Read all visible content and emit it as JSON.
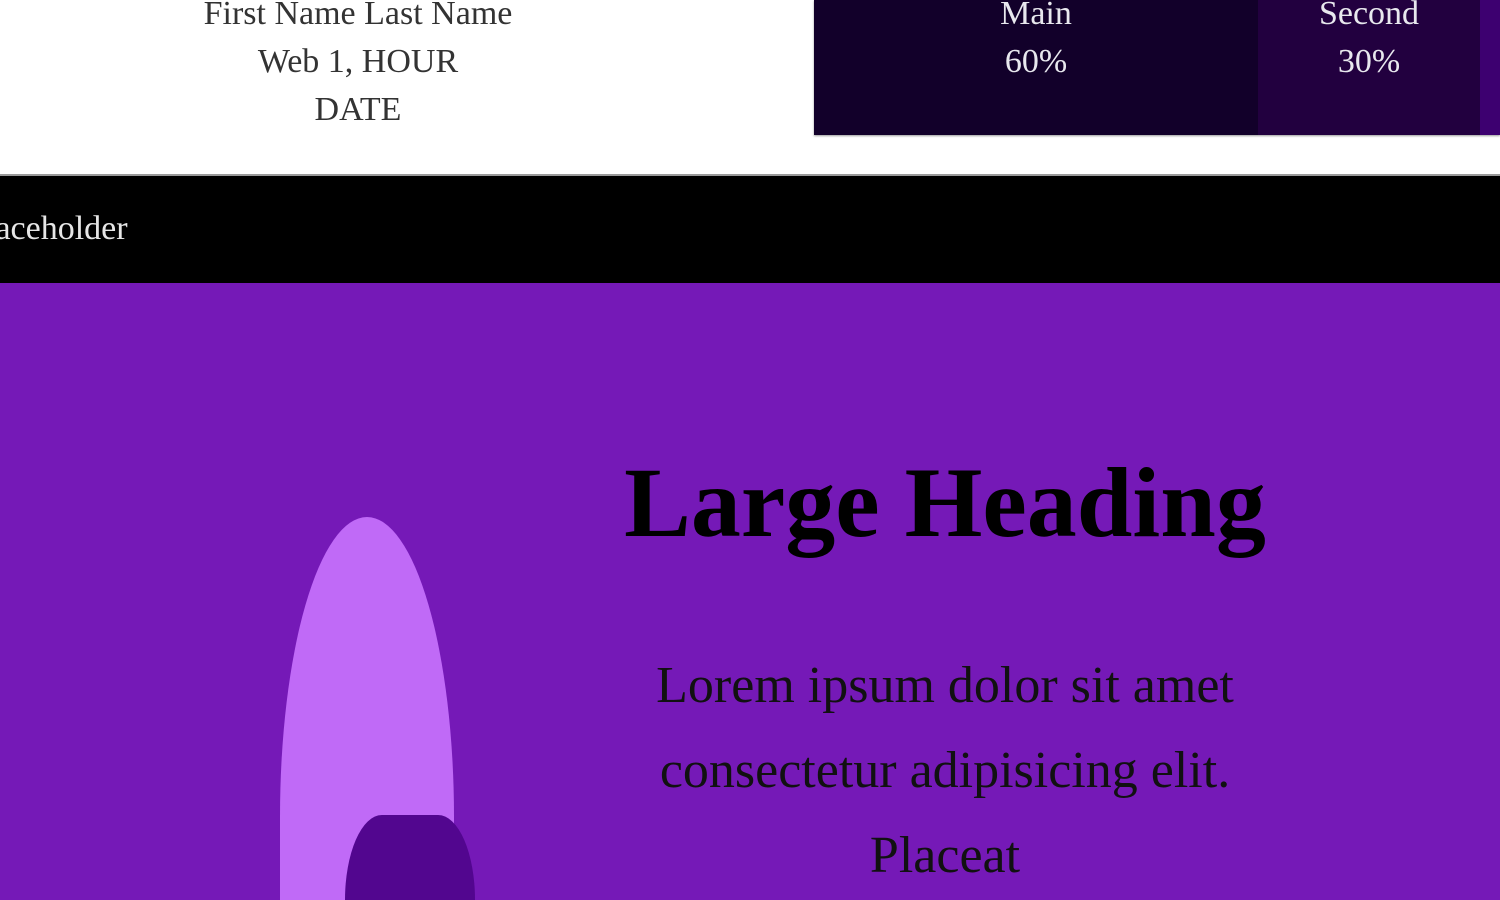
{
  "author": {
    "name": "First Name Last Name",
    "session": "Web 1, HOUR",
    "date": "DATE"
  },
  "stats": [
    {
      "label": "Main",
      "value": "60%"
    },
    {
      "label": "Second",
      "value": "30%"
    },
    {
      "label": "",
      "value": ""
    }
  ],
  "nav": {
    "text": "laceholder"
  },
  "hero": {
    "heading": "Large Heading",
    "paragraph": "Lorem ipsum dolor sit amet consectetur adipisicing elit. Placeat"
  },
  "colors": {
    "hero_bg": "#7519b7",
    "shape_light": "#c06af7",
    "shape_dark": "#52068f",
    "main": "#12002a",
    "second": "#22003f"
  }
}
